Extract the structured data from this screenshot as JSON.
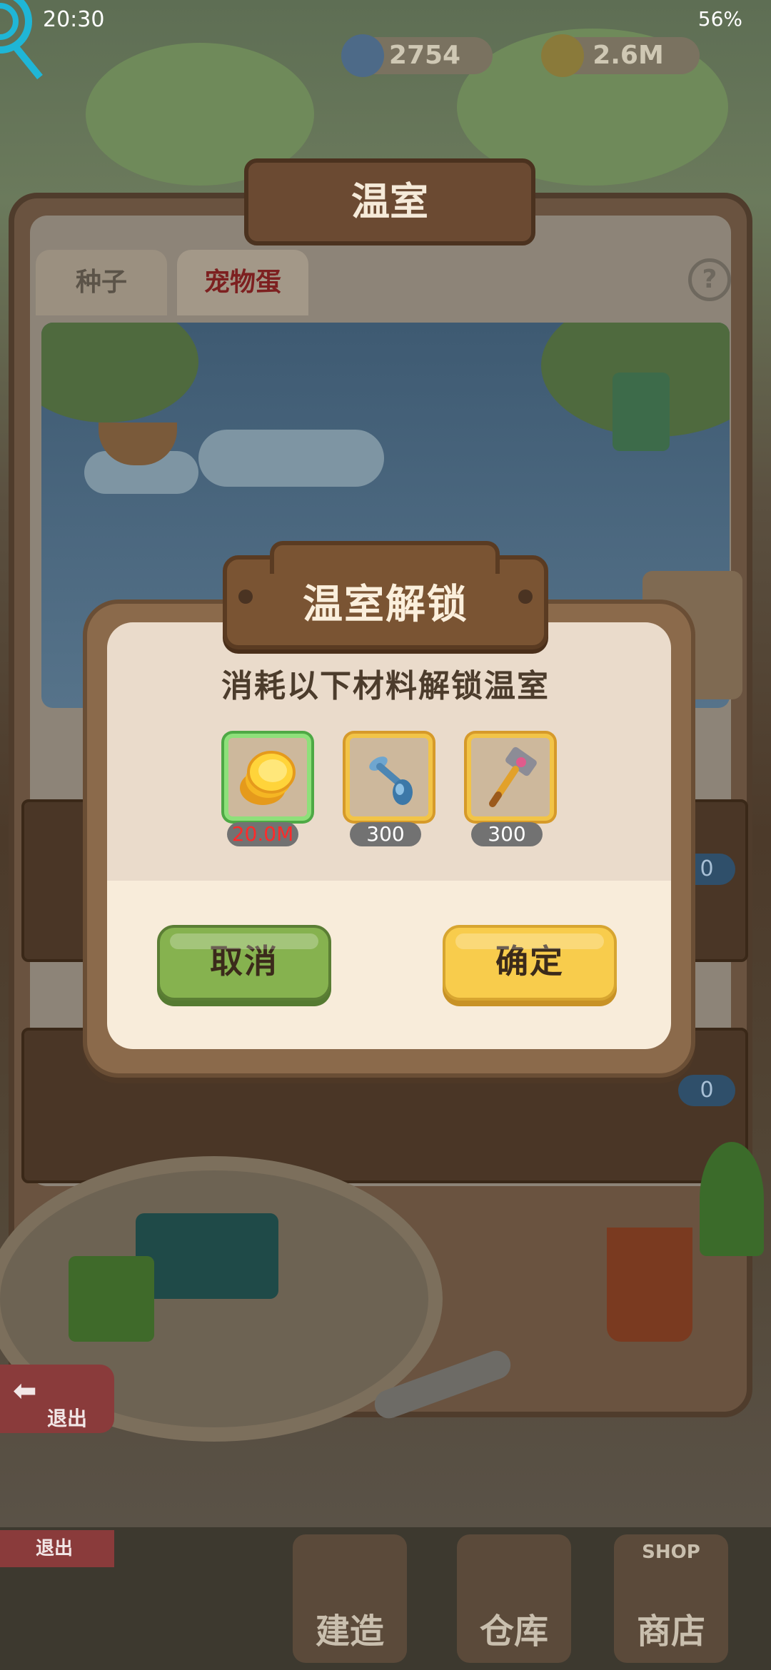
{
  "status_bar": {
    "time": "20:30",
    "battery": "56%"
  },
  "resources": {
    "gems": "2754",
    "coins": "2.6M"
  },
  "greenhouse": {
    "title": "温室",
    "tabs": [
      "种子",
      "宠物蛋"
    ],
    "help": "?",
    "slot_counts": [
      "0",
      "0"
    ]
  },
  "dialog": {
    "title": "温室解锁",
    "description": "消耗以下材料解锁温室",
    "materials": [
      {
        "icon": "coin-stack-icon",
        "amount": "20.0M",
        "insufficient": true
      },
      {
        "icon": "nail-icon",
        "amount": "300",
        "insufficient": false
      },
      {
        "icon": "hammer-icon",
        "amount": "300",
        "insufficient": false
      }
    ],
    "cancel_label": "取消",
    "confirm_label": "确定"
  },
  "bottom_nav": {
    "exit_label": "退出",
    "exit_label_small": "退出",
    "build": "建造",
    "warehouse": "仓库",
    "shop": "商店",
    "shop_sign": "SHOP"
  },
  "colors": {
    "cancel": "#86b24f",
    "confirm": "#f8cc4c",
    "insufficient": "#ff2a2a"
  }
}
